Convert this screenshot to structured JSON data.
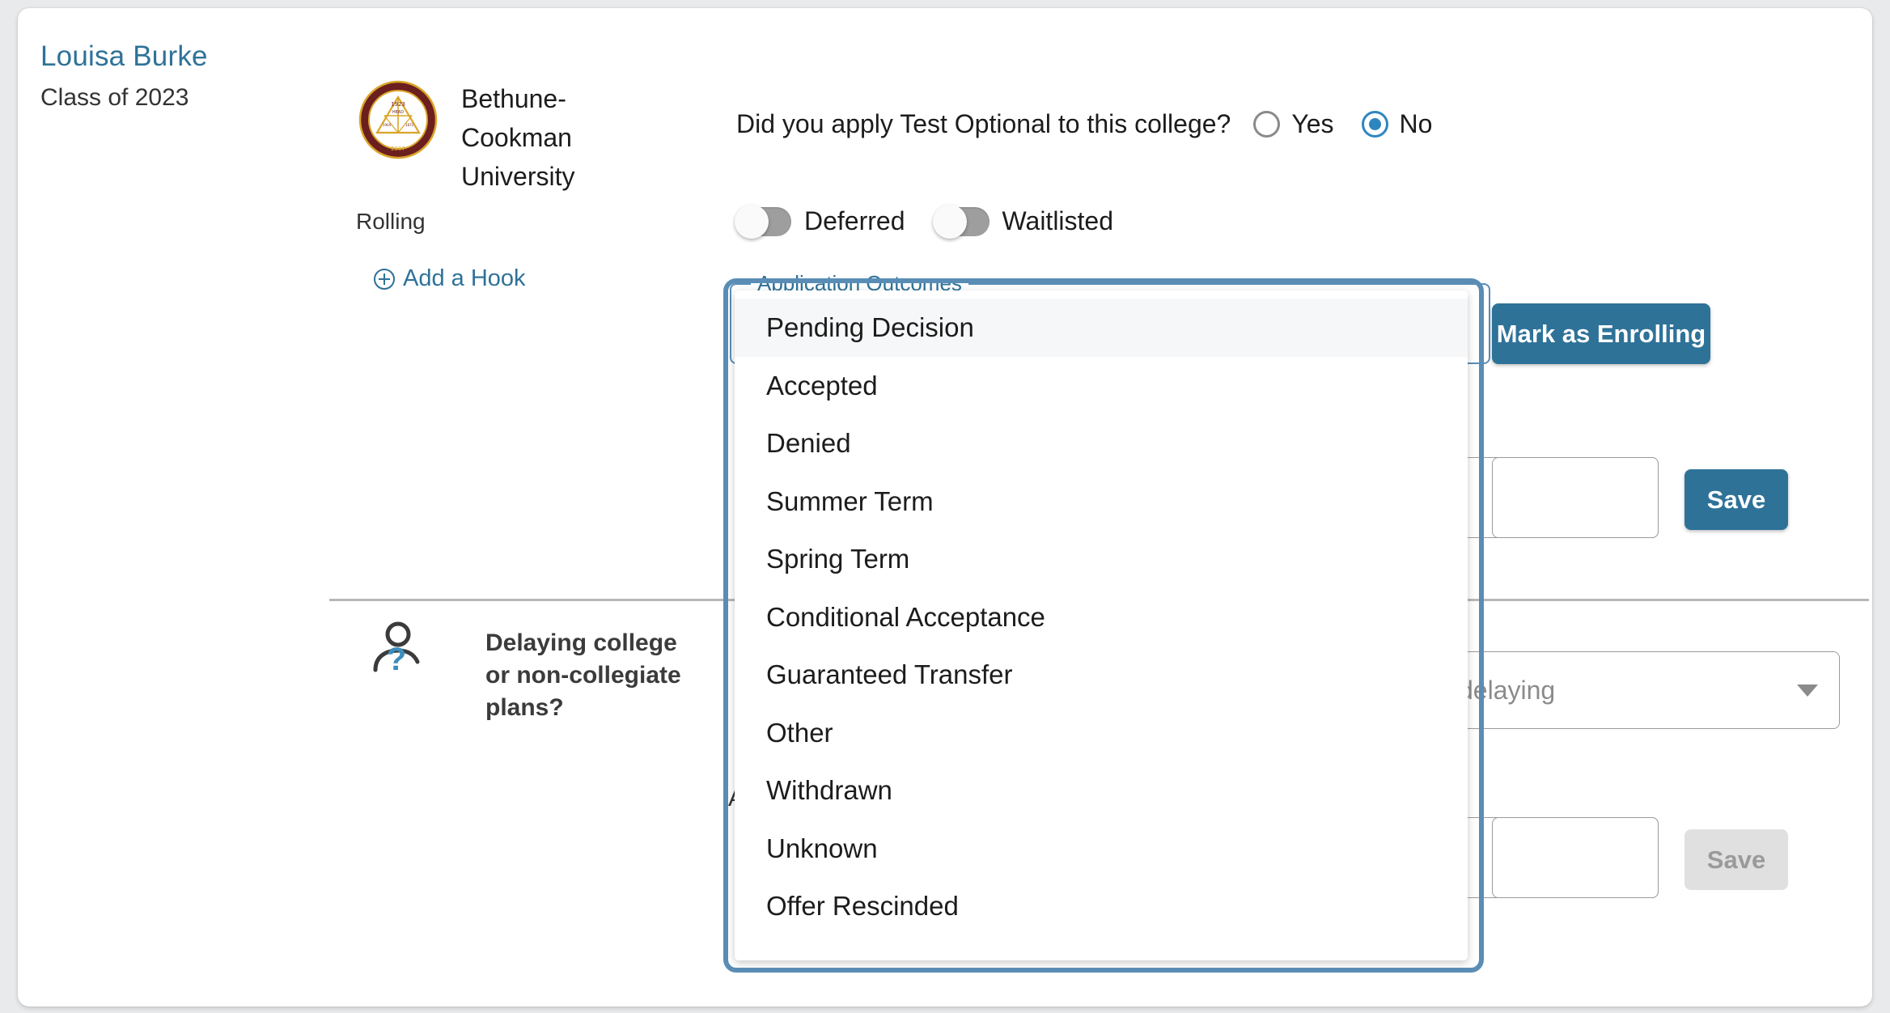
{
  "student": {
    "name": "Louisa Burke",
    "class_year": "Class of 2023"
  },
  "college": {
    "name": "Bethune-Cookman University",
    "logo_alt": "bethune-cookman-seal",
    "deadline_type": "Rolling",
    "add_hook_label": "Add a Hook"
  },
  "test_optional": {
    "question": "Did you apply Test Optional to this college?",
    "options": [
      {
        "label": "Yes",
        "selected": false
      },
      {
        "label": "No",
        "selected": true
      }
    ]
  },
  "status_toggles": [
    {
      "label": "Deferred",
      "on": false
    },
    {
      "label": "Waitlisted",
      "on": false
    }
  ],
  "application_outcomes": {
    "legend": "Application Outcomes",
    "selected": "Pending Decision",
    "options": [
      "Pending Decision",
      "Accepted",
      "Denied",
      "Summer Term",
      "Spring Term",
      "Conditional Acceptance",
      "Guaranteed Transfer",
      "Other",
      "Withdrawn",
      "Unknown",
      "Offer Rescinded"
    ],
    "highlighted_index": 0
  },
  "actions": {
    "mark_as_enrolling": "Mark as Enrolling",
    "save_top": "Save",
    "save_bottom": "Save"
  },
  "inputs": {
    "top_value": "",
    "bottom_value": ""
  },
  "delaying_section": {
    "title": "Delaying college or non-collegiate plans?",
    "select_placeholder": "delaying",
    "icon": "person-question-icon"
  },
  "partial_behind": {
    "letter": "A"
  },
  "colors": {
    "accent_blue": "#2e7298",
    "focus_ring": "#5a8db5",
    "radio_blue": "#2e86c1",
    "toggle_off": "#9e9e9e",
    "divider": "#b7b7b7",
    "disabled_bg": "#e0e0e0",
    "seal_maroon": "#6b1f1f",
    "seal_gold": "#d9a528"
  }
}
